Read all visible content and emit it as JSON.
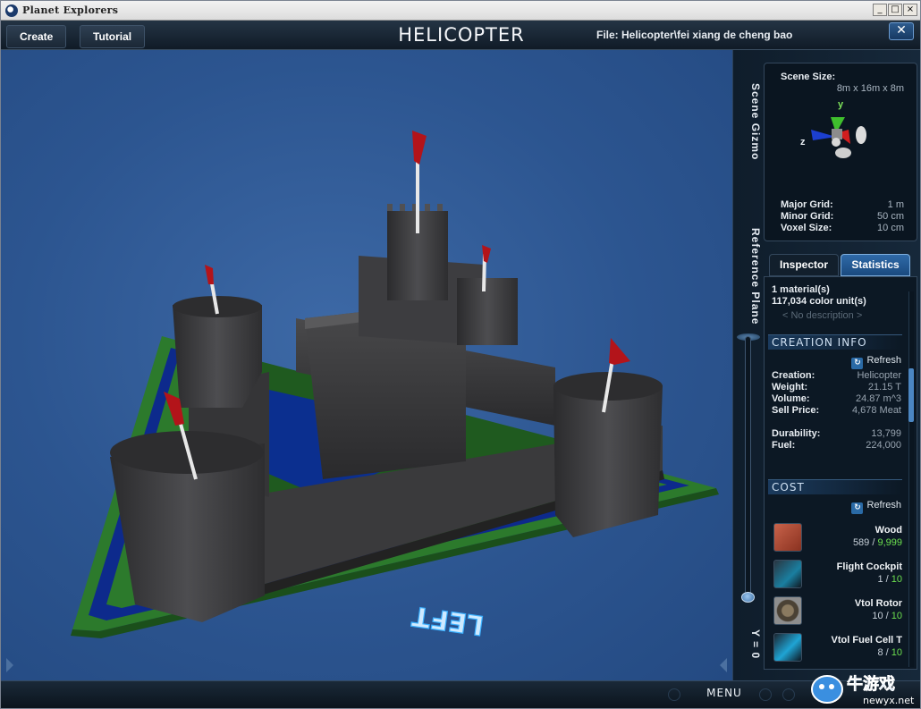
{
  "window": {
    "title": "Planet Explorers",
    "buttons": [
      "_",
      "□",
      "×"
    ]
  },
  "topbar": {
    "create_label": "Create",
    "tutorial_label": "Tutorial",
    "vehicle_title": "HELICOPTER",
    "file_label": "File:  Helicopter\\fei xiang de cheng bao",
    "close_glyph": "✕"
  },
  "viewport": {
    "direction_label": "LEFT"
  },
  "side_tabs": {
    "scene_gizmo": "Scene Gizmo",
    "reference_plane": "Reference Plane",
    "y_readout": "Y = 0"
  },
  "gizmo": {
    "scene_size_label": "Scene Size:",
    "scene_size_value": "8m x 16m x 8m",
    "axis_y": "y",
    "axis_z": "z",
    "major_grid_label": "Major Grid:",
    "major_grid_value": "1 m",
    "minor_grid_label": "Minor Grid:",
    "minor_grid_value": "50 cm",
    "voxel_size_label": "Voxel Size:",
    "voxel_size_value": "10 cm"
  },
  "tabs": {
    "inspector": "Inspector",
    "statistics": "Statistics",
    "active": "statistics"
  },
  "statistics": {
    "materials": "1 material(s)",
    "color_units": "117,034 color unit(s)",
    "description": "< No description >",
    "creation_info_head": "CREATION INFO",
    "refresh_label": "Refresh",
    "refresh_glyph": "↻",
    "rows": [
      {
        "label": "Creation:",
        "value": "Helicopter"
      },
      {
        "label": "Weight:",
        "value": "21.15 T"
      },
      {
        "label": "Volume:",
        "value": "24.87 m^3"
      },
      {
        "label": "Sell Price:",
        "value": "4,678 Meat"
      }
    ],
    "durability_label": "Durability:",
    "durability_value": "13,799",
    "fuel_label": "Fuel:",
    "fuel_value": "224,000",
    "cost_head": "COST",
    "cost_items": [
      {
        "name": "Wood",
        "have": "589",
        "sep": " / ",
        "need": "9,999",
        "thumb": "wood-block-icon"
      },
      {
        "name": "Flight Cockpit",
        "have": "1",
        "sep": " / ",
        "need": "10",
        "thumb": "flight-cockpit-icon"
      },
      {
        "name": "Vtol Rotor",
        "have": "10",
        "sep": " / ",
        "need": "10",
        "thumb": "vtol-rotor-icon"
      },
      {
        "name": "Vtol Fuel Cell T",
        "have": "8",
        "sep": " / ",
        "need": "10",
        "thumb": "fuel-cell-icon"
      }
    ]
  },
  "bottombar": {
    "menu_label": "MENU"
  },
  "watermark": {
    "text": "牛游戏",
    "site": "newyx.net"
  },
  "colors": {
    "accent": "#2a6aa6",
    "required_green": "#6ce04f",
    "viewport_blue": "#2c5590"
  }
}
